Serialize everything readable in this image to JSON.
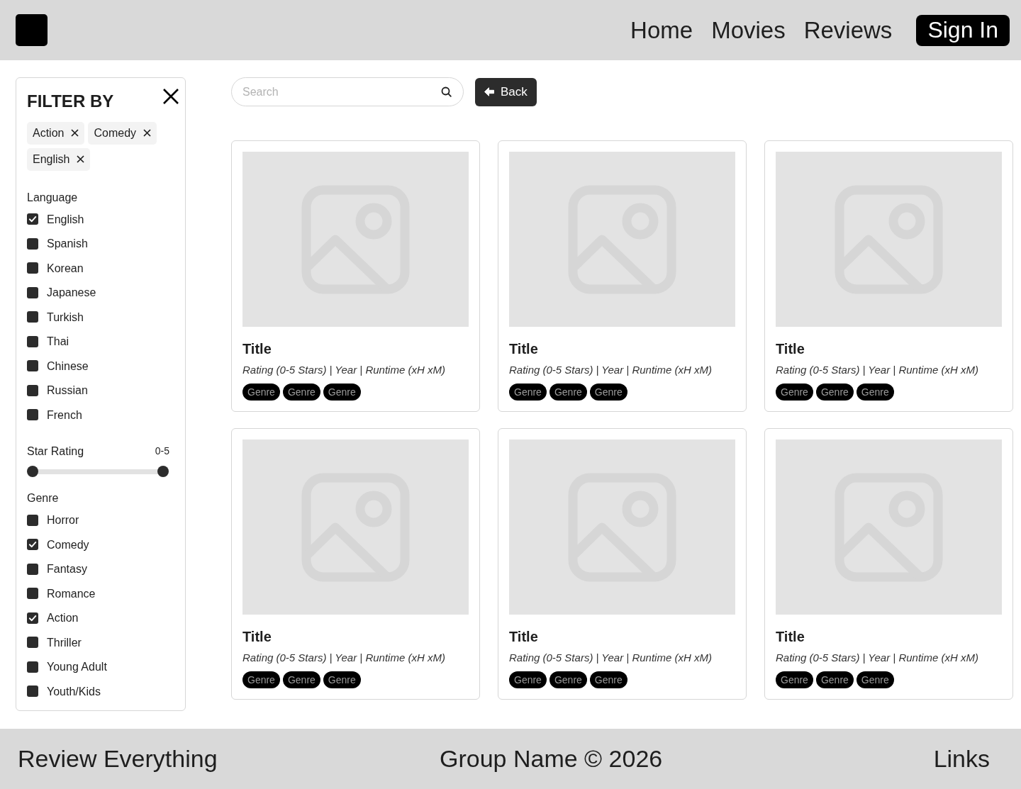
{
  "header": {
    "nav_links": [
      "Home",
      "Movies",
      "Reviews"
    ],
    "sign_in": "Sign In"
  },
  "filters": {
    "title": "FILTER BY",
    "active_filters": [
      "Action",
      "Comedy",
      "English"
    ],
    "language": {
      "label": "Language",
      "options": [
        {
          "label": "English",
          "checked": true
        },
        {
          "label": "Spanish",
          "checked": false
        },
        {
          "label": "Korean",
          "checked": false
        },
        {
          "label": "Japanese",
          "checked": false
        },
        {
          "label": "Turkish",
          "checked": false
        },
        {
          "label": "Thai",
          "checked": false
        },
        {
          "label": "Chinese",
          "checked": false
        },
        {
          "label": "Russian",
          "checked": false
        },
        {
          "label": "French",
          "checked": false
        }
      ]
    },
    "star_rating": {
      "label": "Star Rating",
      "reading": "0-5",
      "thumbs": [
        {
          "level": 0
        },
        {
          "level": 1
        }
      ]
    },
    "genre": {
      "label": "Genre",
      "options": [
        {
          "label": "Horror",
          "checked": false
        },
        {
          "label": "Comedy",
          "checked": true
        },
        {
          "label": "Fantasy",
          "checked": false
        },
        {
          "label": "Romance",
          "checked": false
        },
        {
          "label": "Action",
          "checked": true
        },
        {
          "label": "Thriller",
          "checked": false
        },
        {
          "label": "Young Adult",
          "checked": false
        },
        {
          "label": "Youth/Kids",
          "checked": false
        }
      ]
    }
  },
  "search": {
    "placeholder": "Search"
  },
  "back_button": "Back",
  "movies": [
    {
      "title": "Title",
      "meta": "Rating (0-5 Stars) | Year | Runtime (xH xM)",
      "genres": [
        "Genre",
        "Genre",
        "Genre"
      ]
    },
    {
      "title": "Title",
      "meta": "Rating (0-5 Stars) | Year | Runtime (xH xM)",
      "genres": [
        "Genre",
        "Genre",
        "Genre"
      ]
    },
    {
      "title": "Title",
      "meta": "Rating (0-5 Stars) | Year | Runtime (xH xM)",
      "genres": [
        "Genre",
        "Genre",
        "Genre"
      ]
    },
    {
      "title": "Title",
      "meta": "Rating (0-5 Stars) | Year | Runtime (xH xM)",
      "genres": [
        "Genre",
        "Genre",
        "Genre"
      ]
    },
    {
      "title": "Title",
      "meta": "Rating (0-5 Stars) | Year | Runtime (xH xM)",
      "genres": [
        "Genre",
        "Genre",
        "Genre"
      ]
    },
    {
      "title": "Title",
      "meta": "Rating (0-5 Stars) | Year | Runtime (xH xM)",
      "genres": [
        "Genre",
        "Genre",
        "Genre"
      ]
    }
  ],
  "footer": {
    "left": "Review Everything",
    "center": "Group Name © 2026",
    "right": "Links"
  }
}
